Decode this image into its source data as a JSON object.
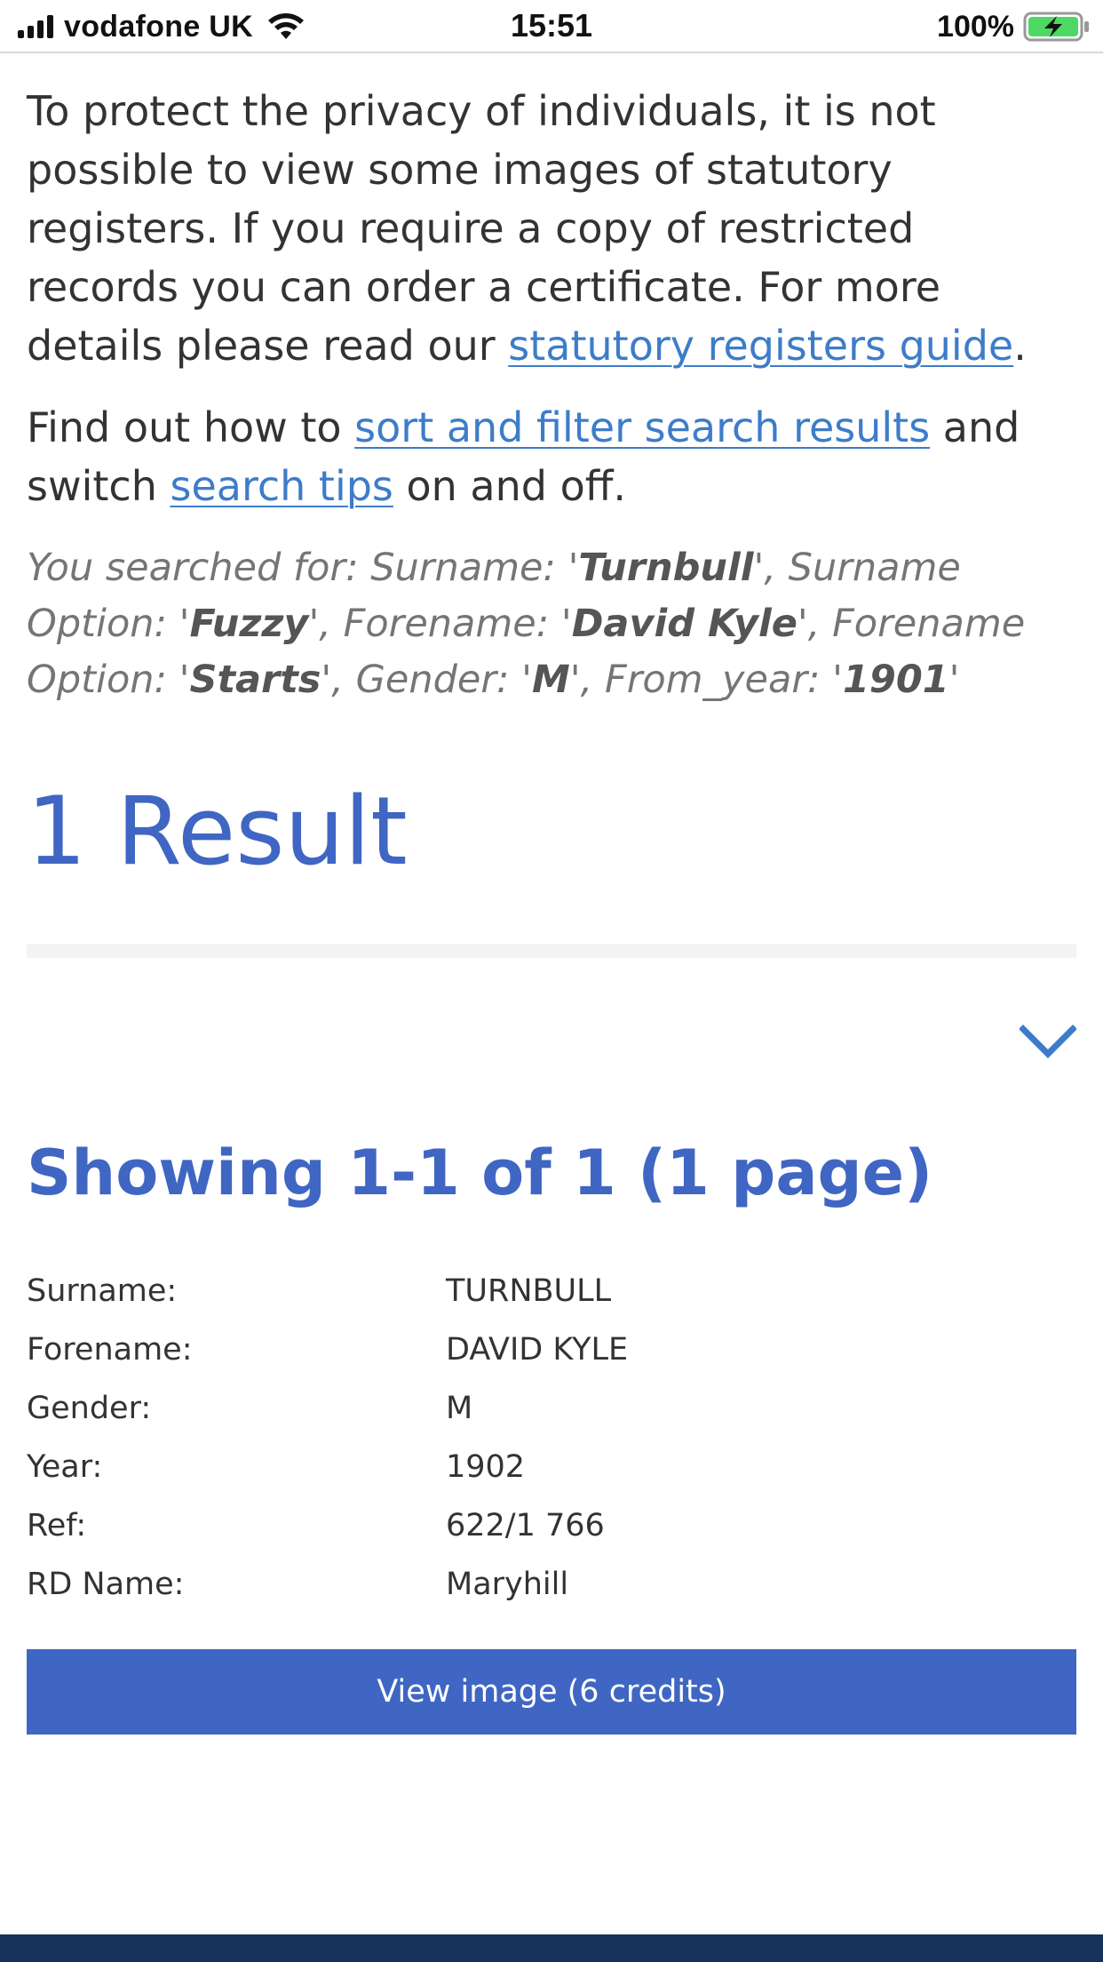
{
  "status_bar": {
    "carrier": "vodafone UK",
    "time": "15:51",
    "battery_percent": "100%",
    "icons": [
      "signal-icon",
      "wifi-icon",
      "battery-charging-icon"
    ]
  },
  "intro": {
    "privacy_text": "To protect the privacy of individuals, it is not possible to view some images of statutory registers. If you require a copy of restricted records you can order a certificate. For more details please read our ",
    "privacy_link": "statutory registers guide",
    "privacy_end": ".",
    "find_out_prefix": "Find out how to ",
    "sort_filter_link": "sort and filter search results",
    "find_out_mid": " and switch ",
    "search_tips_link": "search tips",
    "find_out_end": " on and off."
  },
  "search_summary": {
    "prefix": "You searched for: Surname: '",
    "surname": "Turnbull",
    "after_surname": "', Surname Option: '",
    "surname_option": "Fuzzy",
    "after_surname_option": "', Forename: '",
    "forename": "David Kyle",
    "after_forename": "', Forename Option: '",
    "forename_option": "Starts",
    "after_forename_option": "', Gender: '",
    "gender": "M",
    "after_gender": "', From_year: '",
    "from_year": "1901",
    "suffix": "'"
  },
  "results": {
    "heading": "1 Result",
    "showing": "Showing 1-1 of 1 (1 page)",
    "record": [
      {
        "label": "Surname:",
        "value": "TURNBULL"
      },
      {
        "label": "Forename:",
        "value": "DAVID KYLE"
      },
      {
        "label": "Gender:",
        "value": "M"
      },
      {
        "label": "Year:",
        "value": "1902"
      },
      {
        "label": "Ref:",
        "value": "622/1 766"
      },
      {
        "label": "RD Name:",
        "value": "Maryhill"
      }
    ],
    "view_button": "View image (6 credits)"
  },
  "colors": {
    "accent": "#4066c3",
    "link": "#3d7cc9",
    "footer": "#17325a"
  }
}
